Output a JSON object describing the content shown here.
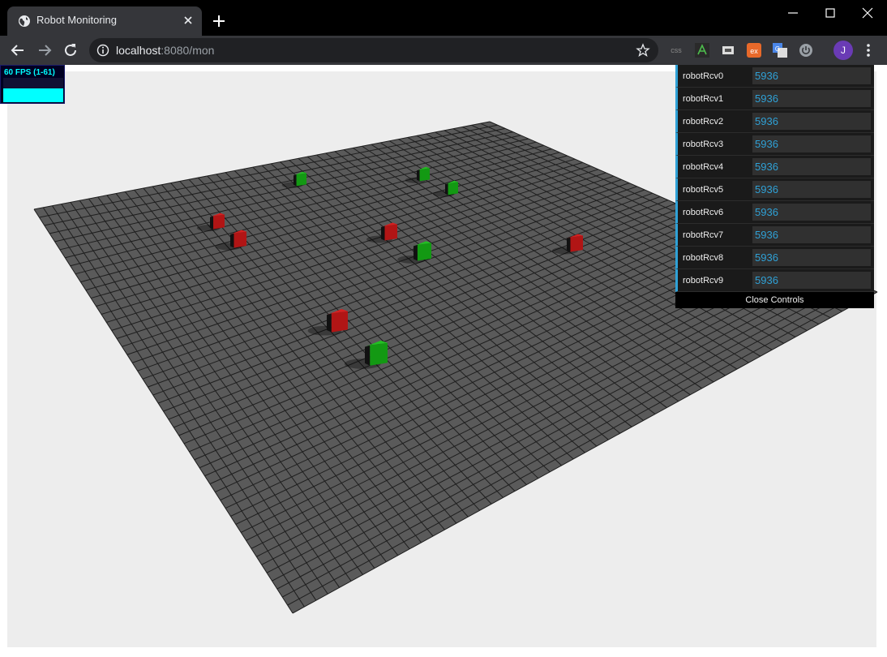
{
  "browser": {
    "tab_title": "Robot Monitoring",
    "url_host": "localhost",
    "url_rest": ":8080/mon",
    "extensions": [
      "css",
      "html-validator-icon",
      "screenshot-icon",
      "ex-icon",
      "translate-icon",
      "power-icon"
    ],
    "avatar_letter": "J"
  },
  "stats": {
    "fps_text": "60 FPS (1-61)",
    "fps_level": 0.98
  },
  "gui": {
    "controls": [
      {
        "label": "robotRcv0",
        "value": "5936"
      },
      {
        "label": "robotRcv1",
        "value": "5936"
      },
      {
        "label": "robotRcv2",
        "value": "5936"
      },
      {
        "label": "robotRcv3",
        "value": "5936"
      },
      {
        "label": "robotRcv4",
        "value": "5936"
      },
      {
        "label": "robotRcv5",
        "value": "5936"
      },
      {
        "label": "robotRcv6",
        "value": "5936"
      },
      {
        "label": "robotRcv7",
        "value": "5936"
      },
      {
        "label": "robotRcv8",
        "value": "5936"
      },
      {
        "label": "robotRcv9",
        "value": "5936"
      }
    ],
    "close_label": "Close Controls"
  },
  "scene": {
    "floor_color": "#5a5a5a",
    "grid_color": "#1e1e1e",
    "robots": [
      {
        "color": "red"
      },
      {
        "color": "green"
      },
      {
        "color": "red"
      },
      {
        "color": "green"
      },
      {
        "color": "red"
      },
      {
        "color": "green"
      },
      {
        "color": "red"
      },
      {
        "color": "green"
      },
      {
        "color": "red"
      },
      {
        "color": "green"
      },
      {
        "color": "red"
      },
      {
        "color": "green"
      }
    ]
  }
}
